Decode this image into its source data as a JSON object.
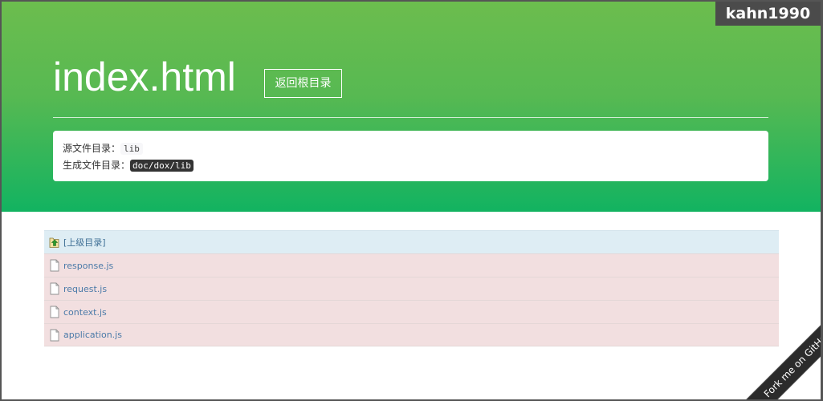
{
  "header": {
    "title": "index.html",
    "back_button_label": "返回根目录"
  },
  "info": {
    "source_dir_label": "源文件目录：",
    "source_dir_value": "lib",
    "output_dir_label": "生成文件目录：",
    "output_dir_value": "doc/dox/lib"
  },
  "listing": {
    "parent_label": "[上级目录]",
    "files": [
      {
        "name": "response.js"
      },
      {
        "name": "request.js"
      },
      {
        "name": "context.js"
      },
      {
        "name": "application.js"
      }
    ]
  },
  "user_badge": "kahn1990",
  "ribbon_label": "Fork me on GitHub",
  "colors": {
    "hero_top": "#6cbd4e",
    "hero_bottom": "#12b361",
    "parent_row_bg": "#deedf4",
    "file_row_bg": "#f2dfe0",
    "link": "#4a7aa8"
  },
  "icons": {
    "parent": "folder-up-icon",
    "file": "file-icon"
  }
}
